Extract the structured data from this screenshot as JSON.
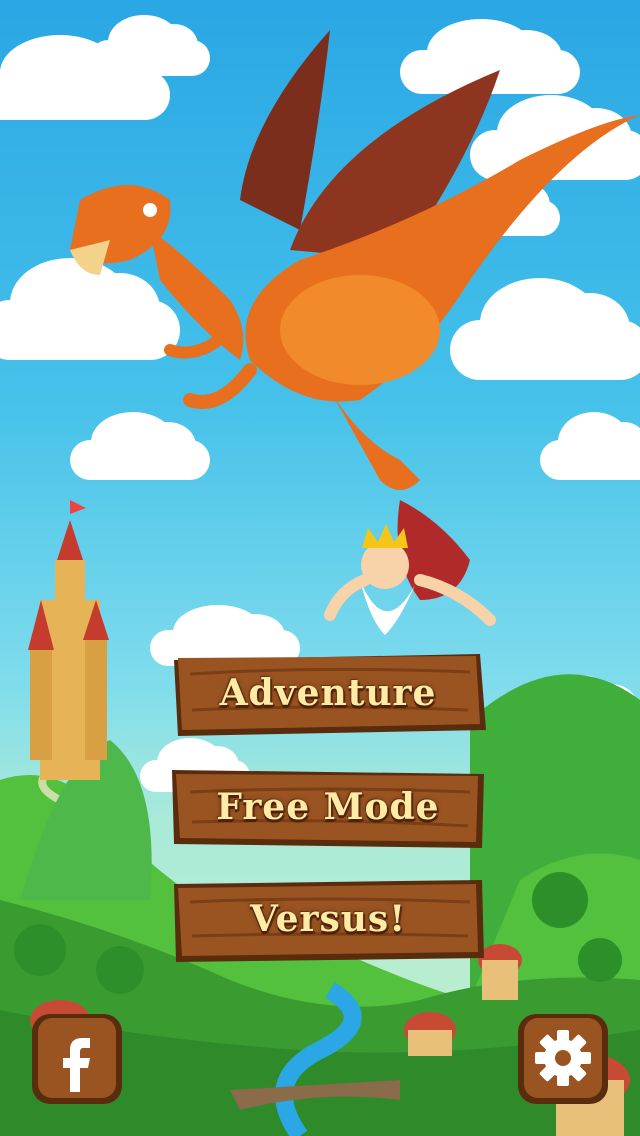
{
  "menu": {
    "adventure_label": "Adventure",
    "free_mode_label": "Free Mode",
    "versus_label": "Versus!"
  },
  "corner_buttons": {
    "facebook_icon": "facebook-icon",
    "settings_icon": "gear-icon"
  },
  "colors": {
    "wood": "#8a4a1c",
    "label": "#ffeaa6",
    "sky": "#2aa7e4"
  }
}
